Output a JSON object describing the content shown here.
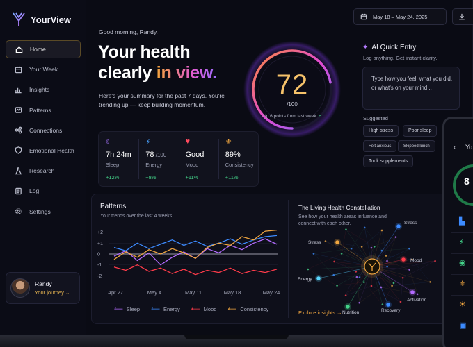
{
  "app": {
    "name": "YourView"
  },
  "sidebar": {
    "items": [
      {
        "label": "Home",
        "icon": "home-icon",
        "active": true
      },
      {
        "label": "Your Week",
        "icon": "calendar-icon"
      },
      {
        "label": "Insights",
        "icon": "bar-chart-icon"
      },
      {
        "label": "Patterns",
        "icon": "pattern-icon"
      },
      {
        "label": "Connections",
        "icon": "connections-icon"
      },
      {
        "label": "Emotional Health",
        "icon": "shield-heart-icon"
      },
      {
        "label": "Research",
        "icon": "flask-icon"
      },
      {
        "label": "Log",
        "icon": "log-icon"
      },
      {
        "label": "Settings",
        "icon": "gear-icon"
      }
    ],
    "profile": {
      "name": "Randy",
      "subtitle": "Your journey",
      "chevron": "⌄"
    }
  },
  "header": {
    "date_range": "May 18 – May 24, 2025"
  },
  "hero": {
    "greeting": "Good morning, Randy.",
    "headline_line1": "Your health",
    "headline_plain": "clearly ",
    "headline_accent": "in view.",
    "summary": "Here's your summary for the past 7 days. You're trending up — keep building momentum."
  },
  "score": {
    "value": "72",
    "denominator": "/100",
    "note": "Up 6 points from last week",
    "note_arrow": "↗",
    "fill_fraction": 0.72
  },
  "stats": [
    {
      "icon": "moon-icon",
      "glyph": "☾",
      "color": "#a875ff",
      "value": "7h 24m",
      "unit": "",
      "label": "Sleep",
      "delta": "+12%"
    },
    {
      "icon": "bolt-icon",
      "glyph": "⚡",
      "color": "#4aa3ff",
      "value": "78",
      "unit": " /100",
      "label": "Energy",
      "delta": "+8%"
    },
    {
      "icon": "heart-icon",
      "glyph": "♥",
      "color": "#ff4a5e",
      "value": "Good",
      "unit": "",
      "label": "Mood",
      "delta": "+11%"
    },
    {
      "icon": "figure-icon",
      "glyph": "⚜",
      "color": "#f0a640",
      "value": "89%",
      "unit": "",
      "label": "Consistency",
      "delta": "+11%"
    }
  ],
  "quick_entry": {
    "title": "AI Quick Entry",
    "spark": "✦",
    "subtitle": "Log anything. Get instant clarity.",
    "placeholder_line1": "Type how you feel, what you did,",
    "placeholder_line2": "or what's on your mind...",
    "suggested_label": "Suggested",
    "chips": [
      "High stress",
      "Poor sleep",
      "Felt anxious",
      "Skipped lunch",
      "Took supplements"
    ]
  },
  "patterns": {
    "title": "Patterns",
    "subtitle": "Your trends over the last 4 weeks",
    "legend": [
      {
        "name": "Sleep",
        "color": "#b36bff"
      },
      {
        "name": "Energy",
        "color": "#3d8bff"
      },
      {
        "name": "Mood",
        "color": "#ff3b4a"
      },
      {
        "name": "Consistency",
        "color": "#f0a640"
      }
    ]
  },
  "chart_data": {
    "type": "line",
    "x_ticks": [
      "Apr 27",
      "May 4",
      "May 11",
      "May 18",
      "May 24"
    ],
    "y_ticks": [
      "+2",
      "+1",
      "0",
      "-1",
      "-2"
    ],
    "ylim": [
      -2.3,
      2.3
    ],
    "series": [
      {
        "name": "Sleep",
        "color": "#b36bff",
        "values": [
          -0.2,
          0.3,
          -0.6,
          0.1,
          -1.0,
          -0.3,
          0.2,
          -0.4,
          0.5,
          0.1,
          0.8,
          0.4,
          1.0,
          1.4,
          0.9
        ]
      },
      {
        "name": "Energy",
        "color": "#3d8bff",
        "values": [
          0.6,
          0.3,
          1.0,
          0.5,
          0.9,
          1.3,
          0.8,
          1.2,
          0.7,
          1.0,
          1.4,
          0.9,
          1.3,
          1.6,
          1.7
        ]
      },
      {
        "name": "Mood",
        "color": "#ff3b4a",
        "values": [
          -1.2,
          -1.5,
          -1.0,
          -1.6,
          -1.3,
          -1.8,
          -1.4,
          -1.9,
          -1.5,
          -1.7,
          -1.3,
          -1.8,
          -1.5,
          -1.7,
          -1.4
        ]
      },
      {
        "name": "Consistency",
        "color": "#f0a640",
        "values": [
          -0.5,
          0.2,
          -0.3,
          0.4,
          0.0,
          0.5,
          0.1,
          -0.4,
          0.6,
          1.0,
          0.8,
          1.6,
          1.3,
          2.1,
          2.2
        ]
      }
    ]
  },
  "constellation": {
    "title": "The Living Health Constellation",
    "subtitle": "See how your health areas influence and connect with each other.",
    "link": "Explore insights →",
    "nodes": [
      {
        "label": "Stress",
        "color": "#f0a640"
      },
      {
        "label": "Stress",
        "color": "#3d8bff"
      },
      {
        "label": "Mood",
        "color": "#ff3b4a"
      },
      {
        "label": "Energy",
        "color": "#5ad6ff"
      },
      {
        "label": "Nutrition",
        "color": "#44d48a"
      },
      {
        "label": "Recovery",
        "color": "#3d8bff"
      },
      {
        "label": "Activation",
        "color": "#b36bff"
      }
    ]
  },
  "phone": {
    "back": "‹",
    "title": "Yo",
    "score_partial": "8",
    "rows": [
      {
        "glyph": "▙",
        "color": "#3d8bff"
      },
      {
        "glyph": "⚡",
        "color": "#44d48a"
      },
      {
        "glyph": "◉",
        "color": "#44d48a"
      },
      {
        "glyph": "⚜",
        "color": "#f0a640"
      },
      {
        "glyph": "☀",
        "color": "#f0a640"
      },
      {
        "glyph": "▣",
        "color": "#3d8bff"
      }
    ]
  }
}
